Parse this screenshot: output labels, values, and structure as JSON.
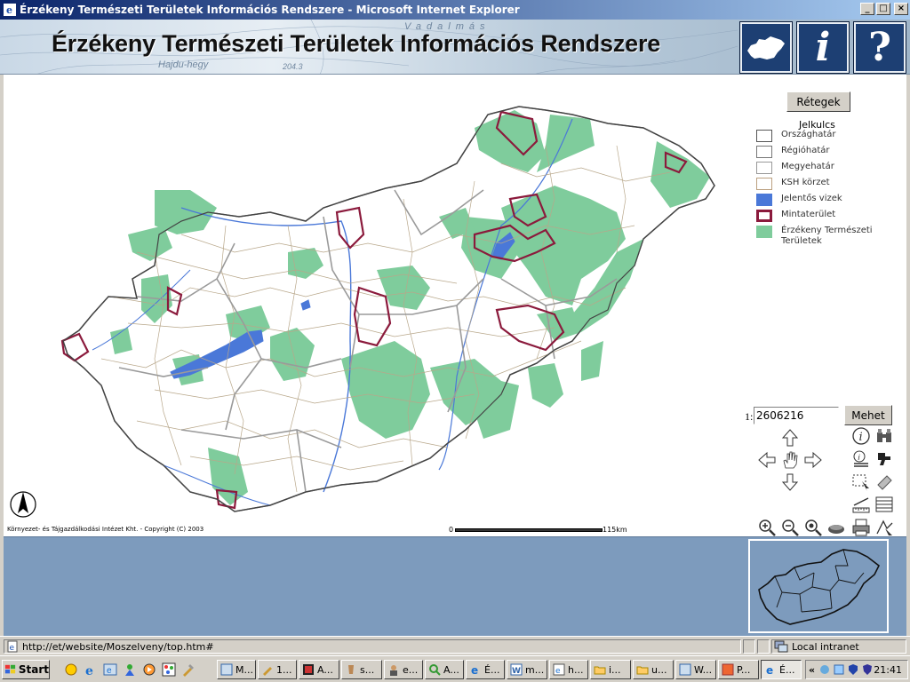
{
  "window": {
    "title": "Érzékeny Természeti Területek Információs Rendszere - Microsoft Internet Explorer",
    "minimize_glyph": "_",
    "maximize_glyph": "□",
    "close_glyph": "×"
  },
  "banner": {
    "title": "Érzékeny Természeti Területek Információs Rendszere",
    "background_map_labels": [
      "Vadalmás",
      "Hajdu-hegy",
      "204.3"
    ],
    "buttons": [
      {
        "name": "hungary-map-button",
        "icon": "hungary-shape-icon"
      },
      {
        "name": "info-button",
        "label": "i"
      },
      {
        "name": "help-button",
        "label": "?"
      }
    ]
  },
  "map": {
    "layers_button": "Rétegek",
    "legend_title": "Jelkulcs",
    "legend": [
      {
        "label": "Országhatár",
        "fill": "#ffffff",
        "stroke": "#555555"
      },
      {
        "label": "Régióhatár",
        "fill": "#ffffff",
        "stroke": "#777777"
      },
      {
        "label": "Megyehatár",
        "fill": "#ffffff",
        "stroke": "#999999"
      },
      {
        "label": "KSH körzet",
        "fill": "#ffffff",
        "stroke": "#bba080"
      },
      {
        "label": "Jelentős vizek",
        "fill": "#4a78d8",
        "stroke": "#4a78d8"
      },
      {
        "label": "Mintaterület",
        "fill": "#ffffff",
        "stroke": "#8b1a3c"
      },
      {
        "label": "Érzékeny Természeti Területek",
        "fill": "#7fcc9c",
        "stroke": "#7fcc9c"
      }
    ],
    "scale_prefix": "1:",
    "scale_value": "2606216",
    "go_button": "Mehet",
    "copyright": "Környezet- és Tájgazdálkodási Intézet Kht. - Copyright (C) 2003",
    "scalebar_start": "0",
    "scalebar_end": "115km",
    "colors": {
      "ett_green": "#7fcc9c",
      "water_blue": "#4a78d8",
      "sample_area": "#8b1a3c",
      "county_border": "#999999",
      "district_border": "#b8a78a"
    }
  },
  "status": {
    "url": "http://et/website/Moszelveny/top.htm#",
    "zone": "Local intranet"
  },
  "taskbar": {
    "start": "Start",
    "tasks": [
      "M...",
      "1...",
      "A...",
      "s...",
      "e...",
      "A...",
      "É...",
      "m...",
      "h...",
      "i...",
      "u...",
      "W...",
      "P...",
      "É..."
    ],
    "tray_arrows": "«",
    "clock": "21:41"
  }
}
